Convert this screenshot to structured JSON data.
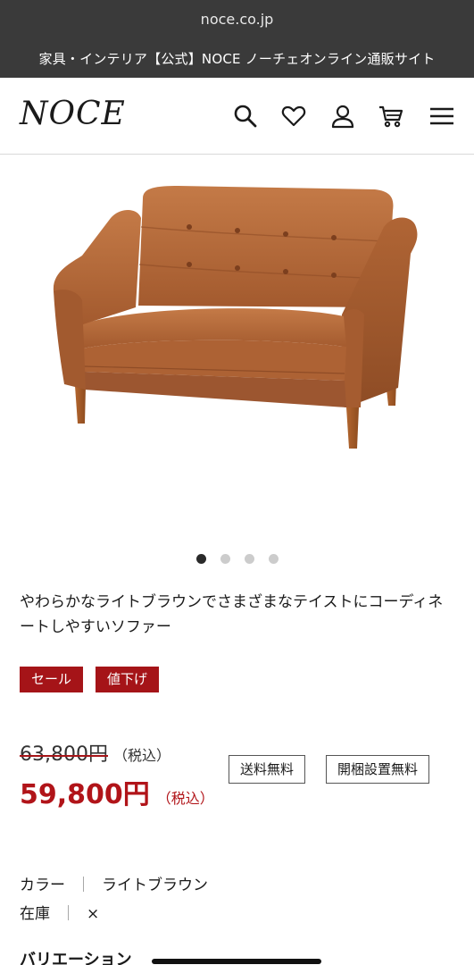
{
  "browser": {
    "url": "noce.co.jp",
    "page_title": "家具・インテリア【公式】NOCE ノーチェオンライン通販サイト"
  },
  "header": {
    "logo": "NOCE",
    "icons": [
      "search-icon",
      "heart-icon",
      "user-icon",
      "cart-icon",
      "menu-icon"
    ]
  },
  "product": {
    "image_dots": {
      "count": 4,
      "active_index": 0
    },
    "description": "やわらかなライトブラウンでさまざまなテイストにコーディネートしやすいソファー",
    "tags": [
      "セール",
      "値下げ"
    ],
    "original_price": "63,800円",
    "original_price_tax": "（税込）",
    "sale_price": "59,800円",
    "sale_price_tax": "（税込）",
    "badges": [
      "送料無料",
      "開梱設置無料"
    ],
    "color_label": "カラー",
    "color_value": "ライトブラウン",
    "stock_label": "在庫",
    "stock_value": "×",
    "spec_separator": "｜",
    "variation_heading": "バリエーション"
  },
  "colors": {
    "accent_red": "#a51418",
    "price_red": "#b11419",
    "browser_bar": "#3a3a3a",
    "sofa_leather": "#b5683a"
  }
}
